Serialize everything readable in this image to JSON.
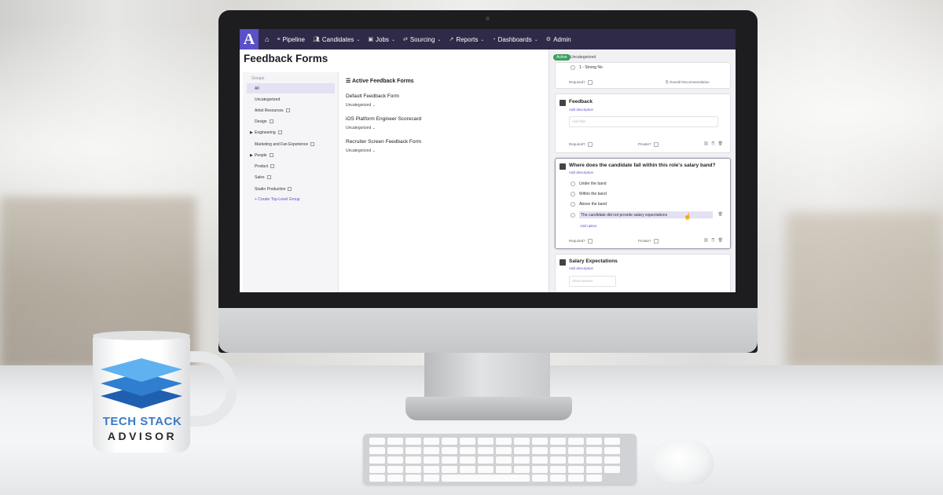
{
  "navbar": {
    "logo": "A",
    "items": [
      {
        "label": "Pipeline",
        "icon": "filter-icon",
        "has_dropdown": false
      },
      {
        "label": "Candidates",
        "icon": "people-icon",
        "has_dropdown": true
      },
      {
        "label": "Jobs",
        "icon": "briefcase-icon",
        "has_dropdown": true
      },
      {
        "label": "Sourcing",
        "icon": "sourcing-icon",
        "has_dropdown": true
      },
      {
        "label": "Reports",
        "icon": "chart-icon",
        "has_dropdown": true
      },
      {
        "label": "Dashboards",
        "icon": "dashboard-icon",
        "has_dropdown": true
      },
      {
        "label": "Admin",
        "icon": "gear-icon",
        "has_dropdown": false
      }
    ]
  },
  "page": {
    "title": "Feedback Forms"
  },
  "groups": {
    "label": "Groups",
    "items": [
      {
        "label": "All",
        "active": true
      },
      {
        "label": "Uncategorized"
      },
      {
        "label": "Artist Resources"
      },
      {
        "label": "Design"
      },
      {
        "label": "Engineering",
        "expandable": true
      },
      {
        "label": "Marketing and Fan Experience"
      },
      {
        "label": "People",
        "expandable": true
      },
      {
        "label": "Product"
      },
      {
        "label": "Sales"
      },
      {
        "label": "Studio Production"
      }
    ],
    "create_label": "+ Create Top-Level Group"
  },
  "forms": {
    "heading": "Active Feedback Forms",
    "items": [
      {
        "title": "Default Feedback Form",
        "tag": "Uncategorized"
      },
      {
        "title": "iOS Platform Engineer Scorecard",
        "tag": "Uncategorized"
      },
      {
        "title": "Recruiter Screen Feedback Form",
        "tag": "Uncategorized"
      }
    ]
  },
  "editor": {
    "status": "Active",
    "category": "Uncategorized",
    "top_card": {
      "option": "1 - Strong No",
      "required_label": "Required?",
      "overall_label": "Overall Recommendation"
    },
    "feedback_card": {
      "title": "Feedback",
      "add_description": "Add description",
      "placeholder": "Add filler",
      "required_label": "Required?",
      "private_label": "Private?"
    },
    "salary_card": {
      "title": "Where does the candidate fall within this role's salary band?",
      "add_description": "Add description",
      "options": [
        "Under the band",
        "Within the band",
        "Above the band",
        "The candidate did not provide salary expectations"
      ],
      "add_option": "Add option",
      "required_label": "Required?",
      "private_label": "Private?"
    },
    "expectations_card": {
      "title": "Salary Expectations",
      "add_description": "Add description",
      "placeholder": "Short answer"
    }
  },
  "mug": {
    "brand_top": "TECH STACK",
    "brand_bottom": "ADVISOR"
  },
  "colors": {
    "navbar": "#2e2a47",
    "accent": "#5a50c8",
    "active_green": "#3f9d5e",
    "logo_blue": "#3a7bc8"
  }
}
